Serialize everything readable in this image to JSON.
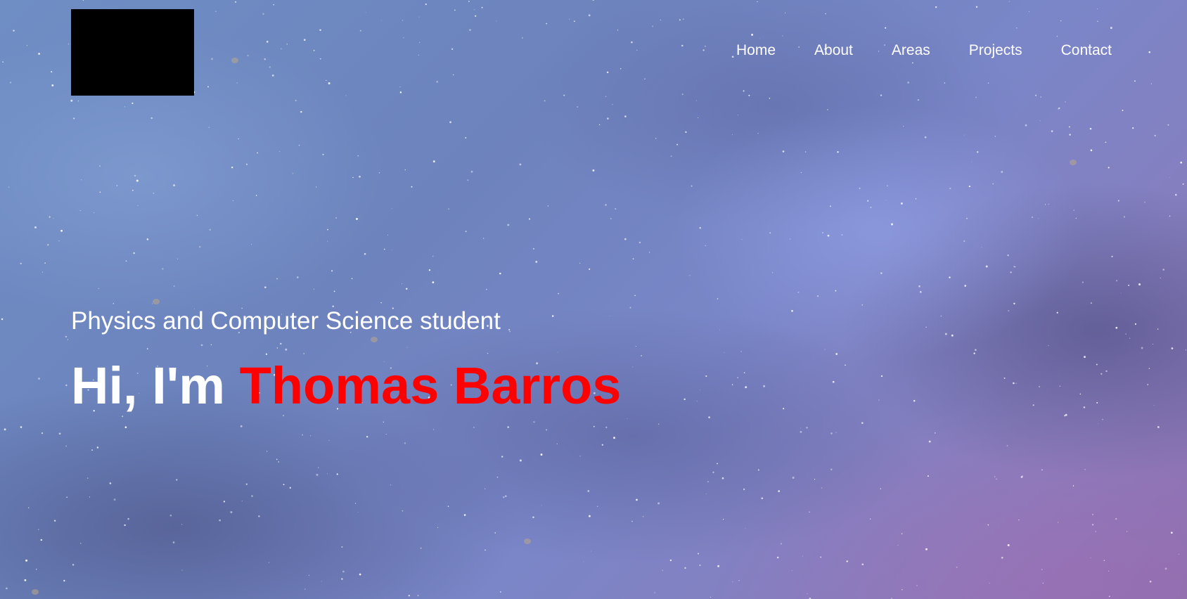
{
  "header": {
    "logo_alt": "",
    "nav": [
      {
        "label": "Home"
      },
      {
        "label": "About"
      },
      {
        "label": "Areas"
      },
      {
        "label": "Projects"
      },
      {
        "label": "Contact"
      }
    ]
  },
  "hero": {
    "subtitle": "Physics and Computer Science student",
    "greeting": "Hi, I'm",
    "name": "Thomas Barros",
    "colors": {
      "name": "#ff0000",
      "text": "#ffffff",
      "logo_box": "#000000"
    },
    "background": "night-sky-stars"
  }
}
